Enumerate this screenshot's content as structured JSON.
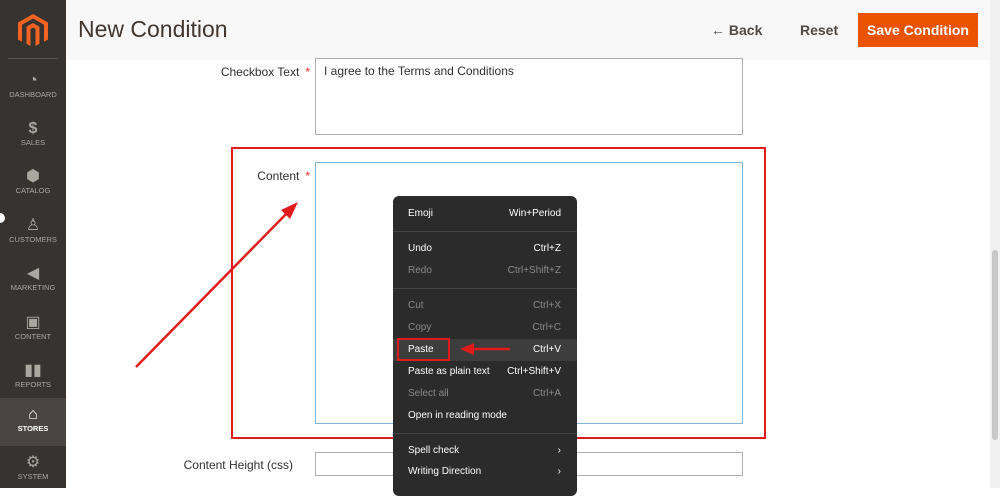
{
  "sidebar": {
    "items": [
      {
        "label": "DASHBOARD",
        "icon": "dashboard-icon"
      },
      {
        "label": "SALES",
        "icon": "dollar-icon"
      },
      {
        "label": "CATALOG",
        "icon": "box-icon"
      },
      {
        "label": "CUSTOMERS",
        "icon": "person-icon"
      },
      {
        "label": "MARKETING",
        "icon": "megaphone-icon"
      },
      {
        "label": "CONTENT",
        "icon": "layout-icon"
      },
      {
        "label": "REPORTS",
        "icon": "bar-chart-icon"
      },
      {
        "label": "STORES",
        "icon": "store-icon",
        "active": true
      },
      {
        "label": "SYSTEM",
        "icon": "gear-icon"
      }
    ]
  },
  "header": {
    "title": "New Condition",
    "back": "Back",
    "reset": "Reset",
    "save": "Save Condition",
    "accent": "#eb5202"
  },
  "form": {
    "checkbox_text_label": "Checkbox Text",
    "checkbox_text_value": "I agree to the Terms and Conditions",
    "content_label": "Content",
    "content_value": "",
    "content_height_label": "Content Height (css)",
    "required": "*"
  },
  "context_menu": {
    "items": [
      {
        "label": "Emoji",
        "shortcut": "Win+Period"
      },
      {
        "label": "Undo",
        "shortcut": "Ctrl+Z"
      },
      {
        "label": "Redo",
        "shortcut": "Ctrl+Shift+Z"
      },
      {
        "label": "Cut",
        "shortcut": "Ctrl+X"
      },
      {
        "label": "Copy",
        "shortcut": "Ctrl+C"
      },
      {
        "label": "Paste",
        "shortcut": "Ctrl+V"
      },
      {
        "label": "Paste as plain text",
        "shortcut": "Ctrl+Shift+V"
      },
      {
        "label": "Select all",
        "shortcut": "Ctrl+A"
      },
      {
        "label": "Open in reading mode",
        "shortcut": ""
      },
      {
        "label": "Spell check",
        "shortcut": "›"
      },
      {
        "label": "Writing Direction",
        "shortcut": "›"
      }
    ]
  }
}
